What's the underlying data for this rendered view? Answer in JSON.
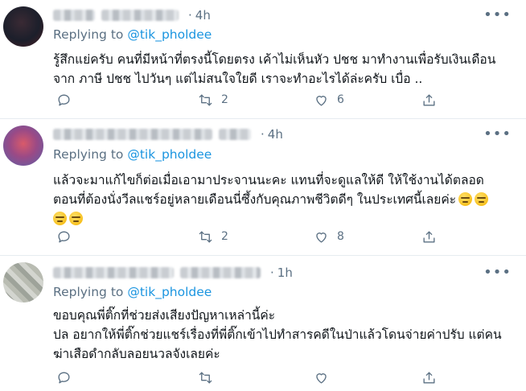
{
  "tweets": [
    {
      "time": "4h",
      "reply_prefix": "Replying to",
      "reply_handle": "@tik_pholdee",
      "lines": [
        "รู้สึกแย่ครับ คนที่มีหน้าที่ตรงนี้โดยตรง เค้าไม่เห็นหัว ปชช มาทำงานเพื่อรับเงินเดือน",
        "จาก ภาษี ปชช ไปวันๆ แต่ไม่สนใจใยดี เราจะทำอะไรได้ล่ะครับ เบื่อ .."
      ],
      "retweet_count": "2",
      "like_count": "6"
    },
    {
      "time": "4h",
      "reply_prefix": "Replying to",
      "reply_handle": "@tik_pholdee",
      "lines": [
        "แล้วจะมาแก้ไขก็ต่อเมื่อเอามาประจานนะคะ แทนที่จะดูแลให้ดี ให้ใช้งานได้ตลอด",
        "ตอนที่ต้องนั่งวีลแชร์อยู่หลายเดือนนี่ซึ้งกับคุณภาพชีวิตดีๆ ในประเทศนี้เลยค่ะ"
      ],
      "emoji": "expressionless-face",
      "retweet_count": "2",
      "like_count": "8"
    },
    {
      "time": "1h",
      "reply_prefix": "Replying to",
      "reply_handle": "@tik_pholdee",
      "lines": [
        "ขอบคุณพี่ติ๊กที่ช่วยส่งเสียงปัญหาเหล่านี้ค่ะ",
        "ปล อยากให้พี่ติ๊กช่วยแชร์เรื่องที่พี่ติ๊กเข้าไปทำสารคดีในป่าแล้วโดนจ่ายค่าปรับ แต่คน",
        "ฆ่าเสือดำกลับลอยนวลจังเลยค่ะ"
      ],
      "retweet_count": "",
      "like_count": ""
    }
  ],
  "icons": {
    "more": "more-icon",
    "reply": "reply-icon",
    "retweet": "retweet-icon",
    "like": "heart-icon",
    "share": "share-icon"
  },
  "colors": {
    "link": "#1b95e0",
    "muted": "#5b7083",
    "divider": "#e6ecf0"
  }
}
